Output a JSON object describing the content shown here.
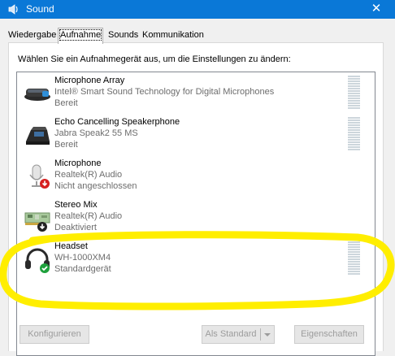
{
  "window": {
    "title": "Sound",
    "close_glyph": "✕"
  },
  "tabs": [
    {
      "label": "Wiedergabe",
      "active": false
    },
    {
      "label": "Aufnahme",
      "active": true
    },
    {
      "label": "Sounds",
      "active": false
    },
    {
      "label": "Kommunikation",
      "active": false
    }
  ],
  "description": "Wählen Sie ein Aufnahmegerät aus, um die Einstellungen zu ändern:",
  "devices": [
    {
      "name": "Microphone Array",
      "driver": "Intel® Smart Sound Technology for Digital Microphones",
      "status": "Bereit",
      "icon": "microphone-array-icon",
      "level": 0
    },
    {
      "name": "Echo Cancelling Speakerphone",
      "driver": "Jabra Speak2 55 MS",
      "status": "Bereit",
      "icon": "speakerphone-icon",
      "level": 0
    },
    {
      "name": "Microphone",
      "driver": "Realtek(R) Audio",
      "status": "Nicht angeschlossen",
      "icon": "microphone-disconnected-icon",
      "level": 0
    },
    {
      "name": "Stereo Mix",
      "driver": "Realtek(R) Audio",
      "status": "Deaktiviert",
      "icon": "stereo-mix-disabled-icon",
      "level": 0
    },
    {
      "name": "Headset",
      "driver": "WH-1000XM4",
      "status": "Standardgerät",
      "icon": "headset-default-icon",
      "level": 0
    }
  ],
  "buttons": {
    "configure": "Konfigurieren",
    "set_default": "Als Standard",
    "properties": "Eigenschaften"
  },
  "colors": {
    "titlebar": "#0a78d7",
    "highlight_annotation": "#ffee00",
    "default_check": "#1ea03c",
    "status_arrow": "#d62020"
  }
}
